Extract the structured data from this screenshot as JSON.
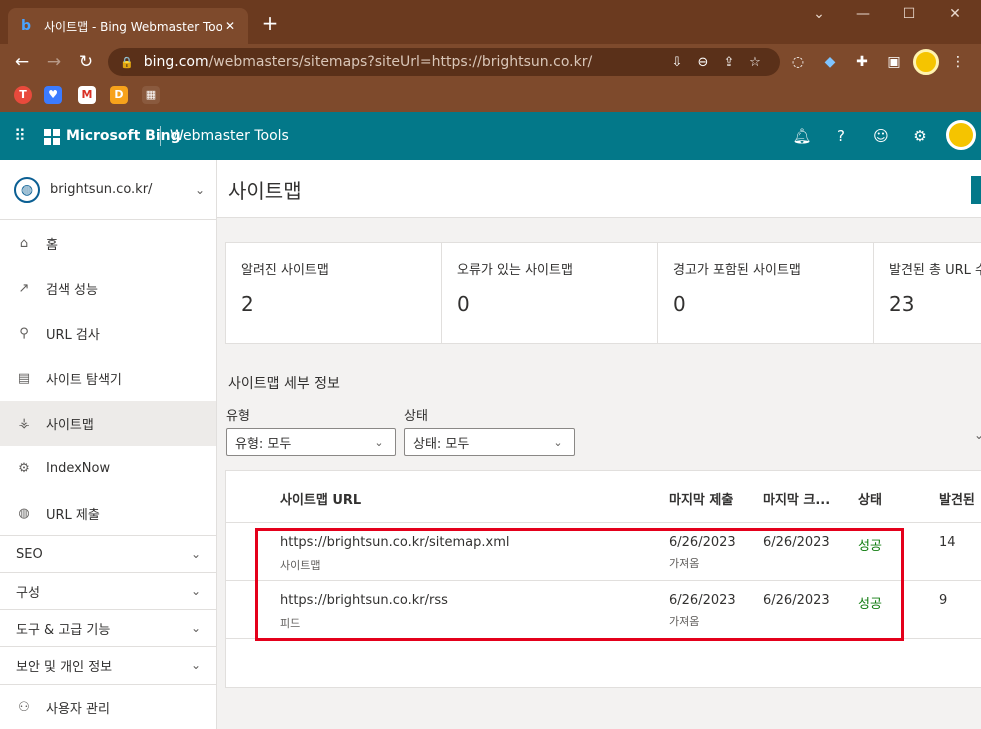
{
  "browser": {
    "tab_title": "사이트맵 - Bing Webmaster Tools",
    "tab_close": "✕",
    "new_tab": "+",
    "url_host": "bing.com",
    "url_path": "/webmasters/sitemaps?siteUrl=https://brightsun.co.kr/",
    "icons": [
      "minimize-icon",
      "maximize-icon",
      "close-icon",
      "back-icon",
      "forward-icon",
      "reload-icon",
      "lock-icon",
      "install-icon",
      "zoom-icon",
      "share-icon",
      "star-icon",
      "extensions-icon"
    ],
    "colors": {
      "frame": "#6b3a1f",
      "toolbar": "#7e4a2c"
    }
  },
  "appbar": {
    "brand": "Microsoft Bing",
    "product": "Webmaster Tools",
    "color": "#037889"
  },
  "sidebar": {
    "site": "brightsun.co.kr/",
    "items": [
      {
        "label": "홈",
        "icon": "home-icon"
      },
      {
        "label": "검색 성능",
        "icon": "trend-icon"
      },
      {
        "label": "URL 검사",
        "icon": "search-icon"
      },
      {
        "label": "사이트 탐색기",
        "icon": "document-icon"
      },
      {
        "label": "사이트맵",
        "icon": "sitemap-icon",
        "active": true
      },
      {
        "label": "IndexNow",
        "icon": "settings-icon"
      },
      {
        "label": "URL 제출",
        "icon": "globe-icon"
      }
    ],
    "groups": [
      {
        "label": "SEO"
      },
      {
        "label": "구성"
      },
      {
        "label": "도구 & 고급 기능"
      },
      {
        "label": "보안 및 개인 정보"
      }
    ],
    "footer": {
      "label": "사용자 관리",
      "icon": "users-icon"
    }
  },
  "main": {
    "page_title": "사이트맵",
    "stats": [
      {
        "label": "알려진 사이트맵",
        "value": "2"
      },
      {
        "label": "오류가 있는 사이트맵",
        "value": "0"
      },
      {
        "label": "경고가 포함된 사이트맵",
        "value": "0"
      },
      {
        "label": "발견된 총 URL 수",
        "value": "23"
      }
    ],
    "section_title": "사이트맵 세부 정보",
    "filters": {
      "type_label": "유형",
      "type_value": "유형: 모두",
      "status_label": "상태",
      "status_value": "상태: 모두"
    },
    "table": {
      "headers": [
        "사이트맵 URL",
        "마지막 제출",
        "마지막 크...",
        "상태",
        "발견된"
      ],
      "rows": [
        {
          "url": "https://brightsun.co.kr/sitemap.xml",
          "type": "사이트맵",
          "submitted": "6/26/2023",
          "submitted_sub": "가져옴",
          "crawled": "6/26/2023",
          "status": "성공",
          "found": "14"
        },
        {
          "url": "https://brightsun.co.kr/rss",
          "type": "피드",
          "submitted": "6/26/2023",
          "submitted_sub": "가져옴",
          "crawled": "6/26/2023",
          "status": "성공",
          "found": "9"
        }
      ]
    }
  }
}
